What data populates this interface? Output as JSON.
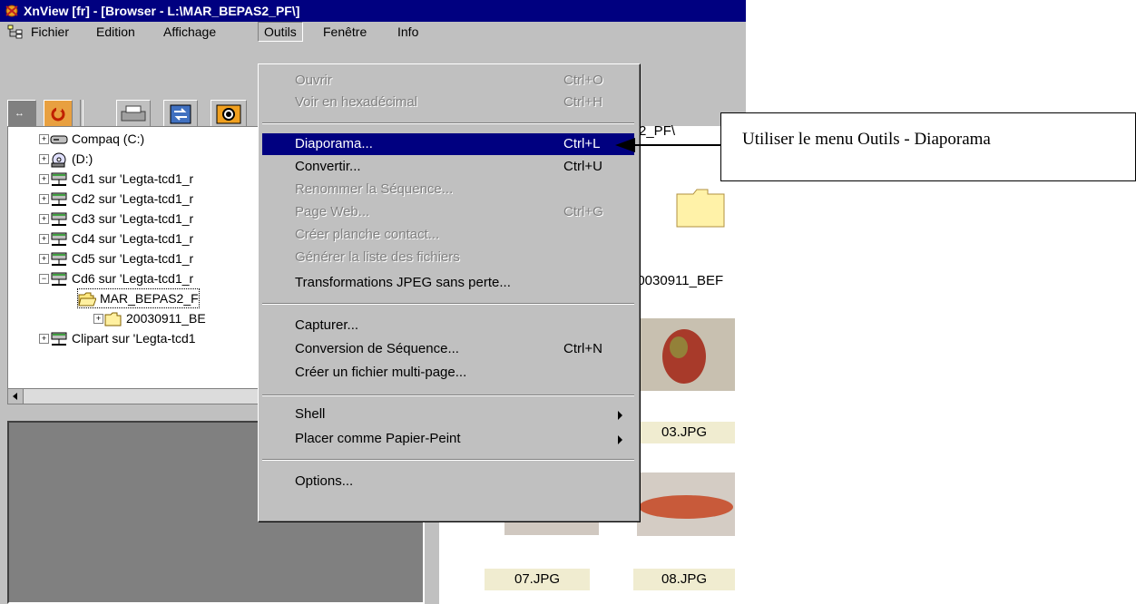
{
  "window": {
    "title": "XnView [fr] - [Browser - L:\\MAR_BEPAS2_PF\\]"
  },
  "menubar": {
    "items": [
      "Fichier",
      "Edition",
      "Affichage",
      "Outils",
      "Fenêtre",
      "Info"
    ],
    "active": "Outils"
  },
  "tree": {
    "nodes": [
      {
        "label": "Compaq (C:)",
        "icon": "drive-icon"
      },
      {
        "label": "(D:)",
        "icon": "cdrom-icon"
      },
      {
        "label": "Cd1 sur 'Legta-tcd1_r",
        "icon": "network-drive-icon"
      },
      {
        "label": "Cd2 sur 'Legta-tcd1_r",
        "icon": "network-drive-icon"
      },
      {
        "label": "Cd3 sur 'Legta-tcd1_r",
        "icon": "network-drive-icon"
      },
      {
        "label": "Cd4 sur 'Legta-tcd1_r",
        "icon": "network-drive-icon"
      },
      {
        "label": "Cd5 sur 'Legta-tcd1_r",
        "icon": "network-drive-icon"
      },
      {
        "label": "Cd6 sur 'Legta-tcd1_r",
        "icon": "network-drive-icon"
      },
      {
        "label": "MAR_BEPAS2_F",
        "icon": "open-folder-icon"
      },
      {
        "label": "20030911_BE",
        "icon": "folder-icon"
      },
      {
        "label": "Clipart sur 'Legta-tcd1",
        "icon": "network-drive-icon"
      }
    ]
  },
  "address": {
    "fragment": "2_PF\\"
  },
  "files": {
    "folder_label": "20030911_BEF",
    "thumbs": [
      {
        "label": "03.JPG"
      },
      {
        "label": "07.JPG"
      },
      {
        "label": "08.JPG"
      }
    ]
  },
  "dropdown": {
    "items": [
      {
        "label": "Ouvrir",
        "shortcut": "Ctrl+O",
        "disabled": true
      },
      {
        "label": "Voir en hexadécimal",
        "shortcut": "Ctrl+H",
        "disabled": true
      },
      {
        "label": "Diaporama...",
        "shortcut": "Ctrl+L",
        "highlight": true
      },
      {
        "label": "Convertir...",
        "shortcut": "Ctrl+U"
      },
      {
        "label": "Renommer la Séquence...",
        "shortcut": "",
        "disabled": true
      },
      {
        "label": "Page Web...",
        "shortcut": "Ctrl+G",
        "disabled": true
      },
      {
        "label": "Créer planche contact...",
        "shortcut": "",
        "disabled": true
      },
      {
        "label": "Générer la liste des fichiers",
        "shortcut": "",
        "disabled": true
      },
      {
        "label": "Transformations JPEG sans perte...",
        "shortcut": ""
      },
      {
        "label": "Capturer...",
        "shortcut": ""
      },
      {
        "label": "Conversion de Séquence...",
        "shortcut": "Ctrl+N"
      },
      {
        "label": "Créer un fichier multi-page...",
        "shortcut": ""
      },
      {
        "label": "Shell",
        "shortcut": "",
        "submenu": true
      },
      {
        "label": "Placer comme Papier-Peint",
        "shortcut": "",
        "submenu": true
      },
      {
        "label": "Options...",
        "shortcut": ""
      }
    ]
  },
  "annotation": {
    "text": "Utiliser le menu Outils - Diaporama"
  },
  "colors": {
    "titlebar": "#000080",
    "highlight": "#000080",
    "face": "#c0c0c0",
    "thumb_label_bg": "#f0ecd0"
  }
}
